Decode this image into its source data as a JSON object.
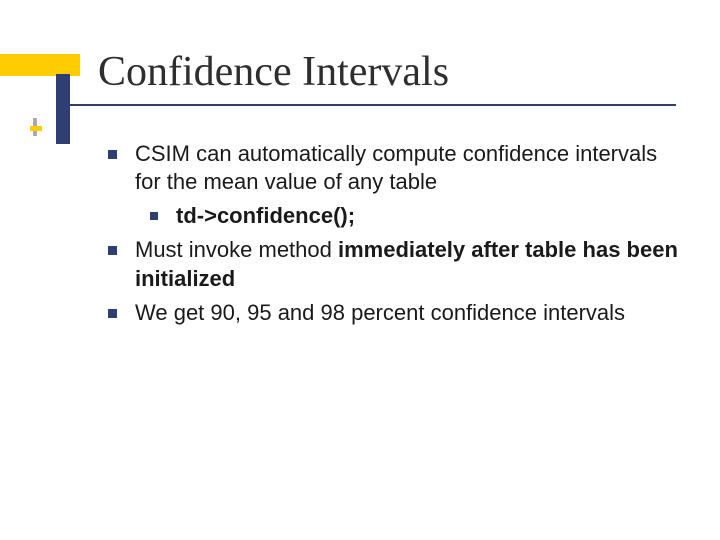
{
  "title": "Confidence Intervals",
  "bullets": {
    "b1": "CSIM can automatically compute confidence intervals for the mean value of any table",
    "b1a_code": "td->confidence();",
    "b2_pre": "Must invoke method ",
    "b2_bold": "immediately after table has been initialized",
    "b3": "We get 90, 95 and 98 percent confidence intervals"
  }
}
